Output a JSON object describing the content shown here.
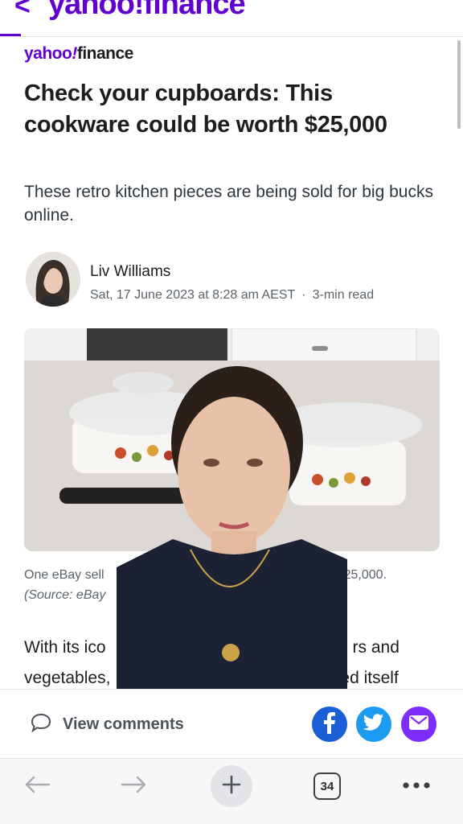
{
  "top_nav": {
    "back_glyph": "<",
    "logo_text": "yahoo!finance"
  },
  "brand": {
    "part1": "yahoo",
    "part2": "!",
    "part3": "finance"
  },
  "article": {
    "headline": "Check your cupboards: This cookware could be worth $25,000",
    "subheadline": "These retro kitchen pieces are being sold for big bucks online.",
    "author": "Liv Williams",
    "date": "Sat, 17 June 2023 at 8:28 am AEST",
    "separator": "·",
    "read_time": "3-min read",
    "caption_left": "One eBay sell",
    "caption_right": "for $25,000.",
    "caption_source": "(Source: eBay",
    "body_line1_left": "With its ico",
    "body_line1_right": "rs and",
    "body_line2_left": "vegetables,",
    "body_line2_right": "ed itself"
  },
  "action_bar": {
    "comments_label": "View comments",
    "comment_icon": "speech-bubble-icon",
    "share_icons": [
      "facebook-icon",
      "twitter-icon",
      "mail-icon"
    ]
  },
  "browser_bar": {
    "tab_count": "34",
    "icons": [
      "back-arrow-icon",
      "forward-arrow-icon",
      "plus-icon",
      "tabs-icon",
      "more-icon"
    ]
  },
  "colors": {
    "brand_purple": "#6001d2",
    "facebook": "#1a5fd6",
    "twitter": "#1d9bf0",
    "mail": "#7d2eff"
  }
}
